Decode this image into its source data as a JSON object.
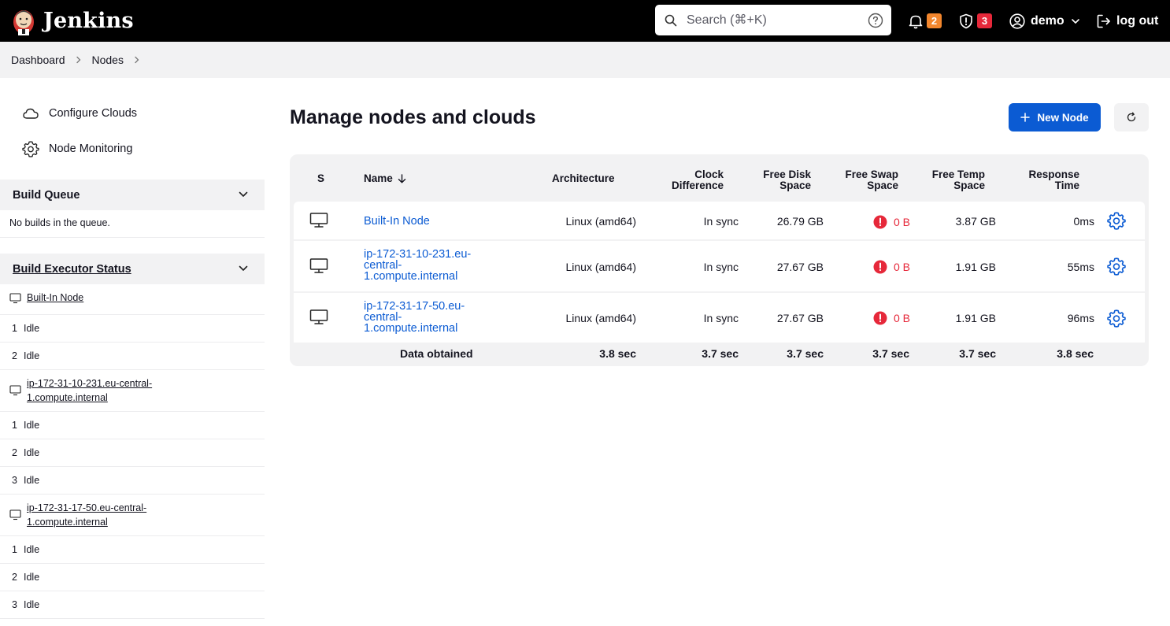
{
  "header": {
    "brand": "Jenkins",
    "search_placeholder": "Search (⌘+K)",
    "notifications_count": "2",
    "security_count": "3",
    "user": "demo",
    "logout": "log out",
    "colors": {
      "bar": "#000000",
      "notif_badge": "#f2862d",
      "security_badge": "#e6283a"
    }
  },
  "breadcrumb": [
    "Dashboard",
    "Nodes"
  ],
  "sidebar": {
    "tasks": [
      {
        "label": "Configure Clouds",
        "icon": "cloud-icon"
      },
      {
        "label": "Node Monitoring",
        "icon": "gear-icon"
      }
    ],
    "build_queue": {
      "title": "Build Queue",
      "empty": "No builds in the queue."
    },
    "executor_status": {
      "title": "Build Executor Status",
      "computers": [
        {
          "name": "Built-In Node",
          "executors": [
            {
              "num": "1",
              "state": "Idle"
            },
            {
              "num": "2",
              "state": "Idle"
            }
          ]
        },
        {
          "name_line1": "ip-172-31-10-231.eu-central-",
          "name_line2": "1.compute.internal",
          "executors": [
            {
              "num": "1",
              "state": "Idle"
            },
            {
              "num": "2",
              "state": "Idle"
            },
            {
              "num": "3",
              "state": "Idle"
            }
          ]
        },
        {
          "name_line1": "ip-172-31-17-50.eu-central-",
          "name_line2": "1.compute.internal",
          "executors": [
            {
              "num": "1",
              "state": "Idle"
            },
            {
              "num": "2",
              "state": "Idle"
            },
            {
              "num": "3",
              "state": "Idle"
            }
          ]
        }
      ]
    }
  },
  "main": {
    "title": "Manage nodes and clouds",
    "new_node_label": "New Node",
    "accent": "#0b5bd3",
    "columns": {
      "s": "S",
      "name": "Name",
      "arch": "Architecture",
      "clock_1": "Clock",
      "clock_2": "Difference",
      "disk_1": "Free Disk",
      "disk_2": "Space",
      "swap_1": "Free Swap",
      "swap_2": "Space",
      "temp_1": "Free Temp",
      "temp_2": "Space",
      "resp_1": "Response",
      "resp_2": "Time"
    },
    "rows": [
      {
        "name_1": "Built-In Node",
        "arch": "Linux (amd64)",
        "clock": "In sync",
        "disk": "26.79 GB",
        "swap": "0 B",
        "temp": "3.87 GB",
        "resp": "0ms"
      },
      {
        "name_1": "ip-172-31-10-231.eu-",
        "name_2": "central-",
        "name_3": "1.compute.internal",
        "arch": "Linux (amd64)",
        "clock": "In sync",
        "disk": "27.67 GB",
        "swap": "0 B",
        "temp": "1.91 GB",
        "resp": "55ms"
      },
      {
        "name_1": "ip-172-31-17-50.eu-",
        "name_2": "central-",
        "name_3": "1.compute.internal",
        "arch": "Linux (amd64)",
        "clock": "In sync",
        "disk": "27.67 GB",
        "swap": "0 B",
        "temp": "1.91 GB",
        "resp": "96ms"
      }
    ],
    "footer": {
      "label": "Data obtained",
      "arch": "3.8 sec",
      "clock": "3.7 sec",
      "disk": "3.7 sec",
      "swap": "3.7 sec",
      "temp": "3.7 sec",
      "resp": "3.8 sec"
    }
  }
}
